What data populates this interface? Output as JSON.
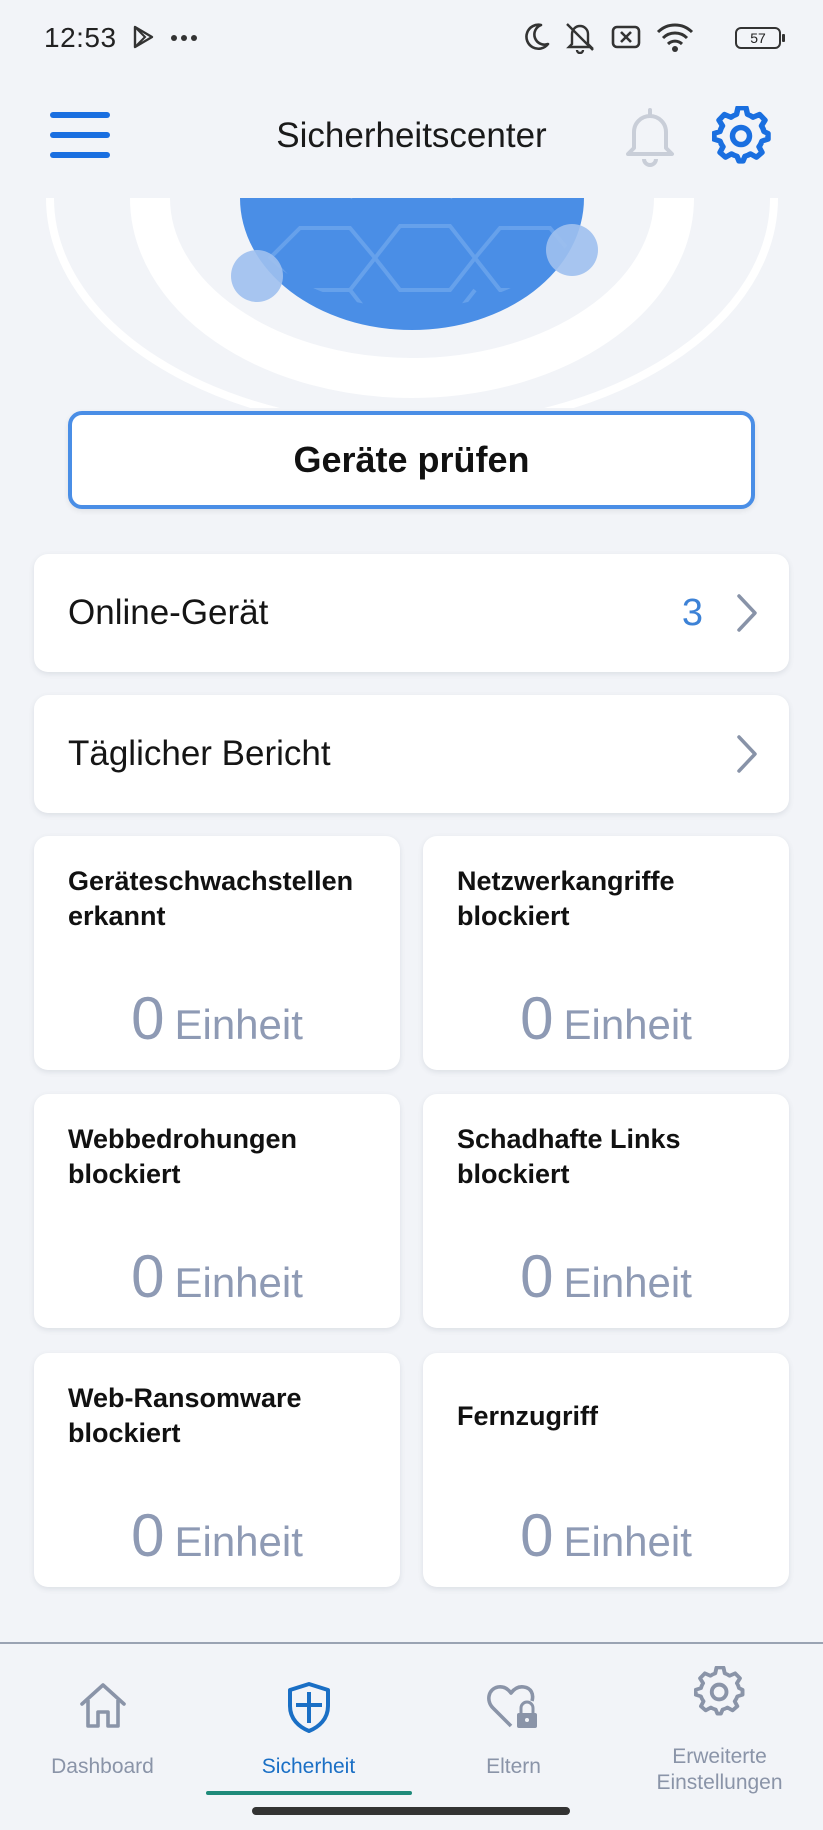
{
  "status_bar": {
    "time": "12:53",
    "battery": "57"
  },
  "header": {
    "title": "Sicherheitscenter",
    "menu_icon": "hamburger-menu-icon",
    "bell_icon": "bell-icon",
    "settings_icon": "gear-icon"
  },
  "scan_button": {
    "label": "Geräte prüfen"
  },
  "rows": [
    {
      "label": "Online-Gerät",
      "count": "3"
    },
    {
      "label": "Täglicher Bericht",
      "count": ""
    }
  ],
  "stats": [
    {
      "title": "Geräteschwachstellen erkannt",
      "value": "0",
      "unit": "Einheit"
    },
    {
      "title": "Netzwerkangriffe blockiert",
      "value": "0",
      "unit": "Einheit"
    },
    {
      "title": "Webbedrohungen blockiert",
      "value": "0",
      "unit": "Einheit"
    },
    {
      "title": "Schadhafte Links blockiert",
      "value": "0",
      "unit": "Einheit"
    },
    {
      "title": "Web-Ransomware blockiert",
      "value": "0",
      "unit": "Einheit"
    },
    {
      "title": "Fernzugriff",
      "value": "0",
      "unit": "Einheit"
    }
  ],
  "nav": [
    {
      "label": "Dashboard",
      "icon": "home-icon",
      "active": false
    },
    {
      "label": "Sicherheit",
      "icon": "shield-icon",
      "active": true
    },
    {
      "label": "Eltern",
      "icon": "heart-lock-icon",
      "active": false
    },
    {
      "label": "Erweiterte Einstellungen",
      "icon": "gear-icon",
      "active": false
    }
  ],
  "colors": {
    "accent": "#1a6fe0",
    "active_nav": "#1a6fc5",
    "indicator": "#1f8a7a",
    "muted_value": "#8e9ab4",
    "background": "#f2f4f8"
  }
}
